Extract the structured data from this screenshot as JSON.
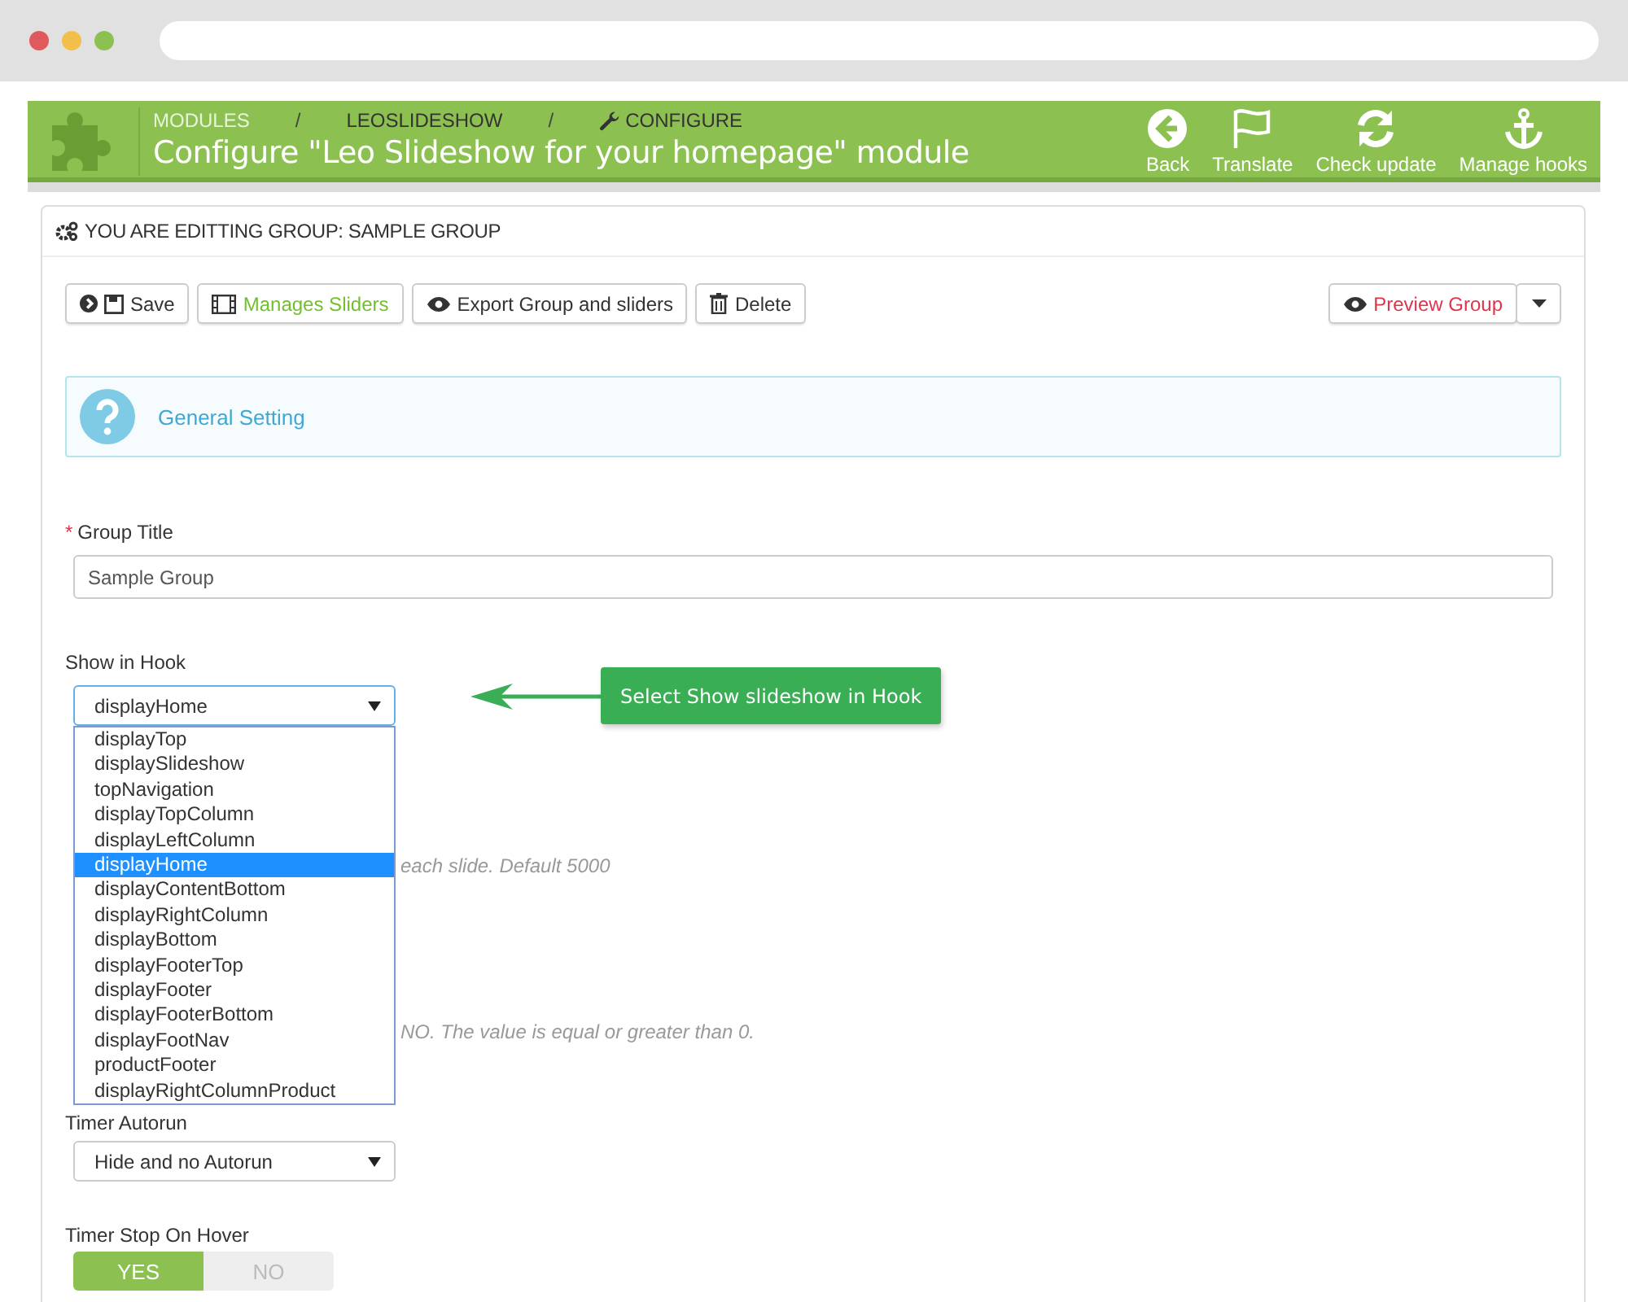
{
  "breadcrumb_separator": "/",
  "breadcrumb": [
    {
      "label": "MODULES",
      "kind": "plain"
    },
    {
      "label": "LEOSLIDESHOW",
      "kind": "plain"
    },
    {
      "label": "CONFIGURE",
      "kind": "wrench"
    }
  ],
  "page_title": "Configure \"Leo Slideshow for your homepage\" module",
  "toolbar": [
    {
      "label": "Back",
      "kind": "back"
    },
    {
      "label": "Translate",
      "kind": "flag"
    },
    {
      "label": "Check update",
      "kind": "refresh"
    },
    {
      "label": "Manage hooks",
      "kind": "anchor"
    }
  ],
  "panel": {
    "heading": "YOU ARE EDITTING GROUP: SAMPLE GROUP",
    "buttons": [
      {
        "label": "Save",
        "kind": "save"
      },
      {
        "label": "Manages Sliders",
        "kind": "sliders"
      },
      {
        "label": "Export Group and sliders",
        "kind": "export"
      },
      {
        "label": "Delete",
        "kind": "delete"
      }
    ],
    "preview_button": "Preview Group",
    "section": "General Setting",
    "group_title": {
      "label": "Group Title",
      "required_mark": "*",
      "value": "Sample Group"
    },
    "hook": {
      "label": "Show in Hook",
      "value": "displayHome",
      "options": [
        {
          "label": "displayTop",
          "selected": false
        },
        {
          "label": "displaySlideshow",
          "selected": false
        },
        {
          "label": "topNavigation",
          "selected": false
        },
        {
          "label": "displayTopColumn",
          "selected": false
        },
        {
          "label": "displayLeftColumn",
          "selected": false
        },
        {
          "label": "displayHome",
          "selected": true
        },
        {
          "label": "displayContentBottom",
          "selected": false
        },
        {
          "label": "displayRightColumn",
          "selected": false
        },
        {
          "label": "displayBottom",
          "selected": false
        },
        {
          "label": "displayFooterTop",
          "selected": false
        },
        {
          "label": "displayFooter",
          "selected": false
        },
        {
          "label": "displayFooterBottom",
          "selected": false
        },
        {
          "label": "displayFootNav",
          "selected": false
        },
        {
          "label": "productFooter",
          "selected": false
        },
        {
          "label": "displayRightColumnProduct",
          "selected": false
        }
      ]
    },
    "hidden_help": [
      "each slide. Default 5000",
      "NO. The value is equal or greater than 0."
    ],
    "timer_autorun": {
      "label": "Timer Autorun",
      "value": "Hide and no Autorun"
    },
    "timer_stop": {
      "label": "Timer Stop On Hover",
      "options": [
        {
          "label": "YES",
          "selected": true
        },
        {
          "label": "NO",
          "selected": false
        }
      ]
    }
  },
  "callout": "Select Show slideshow in Hook"
}
